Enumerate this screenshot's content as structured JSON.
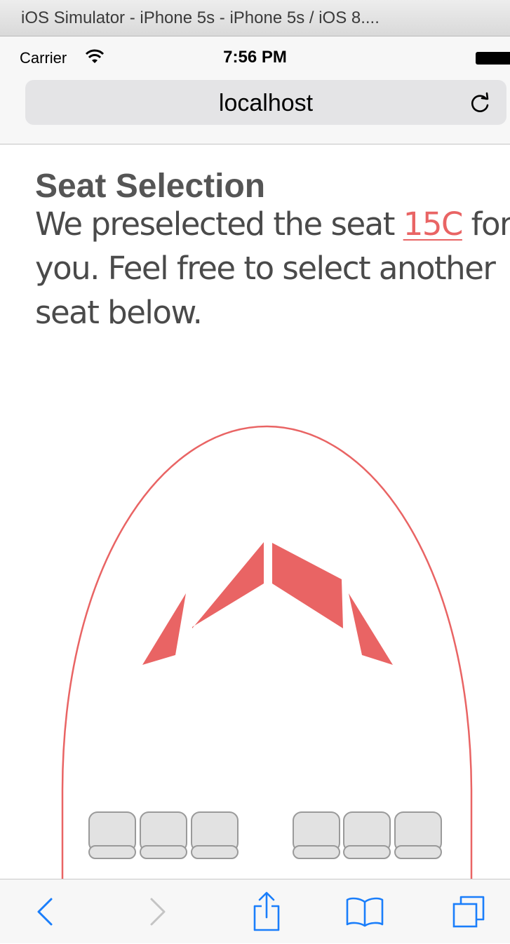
{
  "simulator": {
    "title": "iOS Simulator - iPhone 5s - iPhone 5s / iOS 8...."
  },
  "status_bar": {
    "carrier": "Carrier",
    "time": "7:56 PM",
    "icons": [
      "wifi-icon",
      "battery-icon"
    ]
  },
  "safari": {
    "url": "localhost",
    "reload_icon": "reload-icon",
    "toolbar_icons": [
      "back-chevron-icon",
      "forward-chevron-icon",
      "share-icon",
      "bookmarks-icon",
      "tabs-icon"
    ]
  },
  "page": {
    "title": "Seat Selection",
    "intro_before": "We preselected the seat ",
    "preselected_seat": "15C",
    "intro_after_line1": " for",
    "intro_line2": "you. Feel free to select another",
    "intro_line3": "seat below."
  },
  "colors": {
    "accent": "#e96464",
    "heading": "#555555",
    "body_text": "#4a4a4a",
    "seat_fill": "#e2e2e2",
    "seat_stroke": "#9a9a9a",
    "ios_blue": "#1a7efb"
  }
}
